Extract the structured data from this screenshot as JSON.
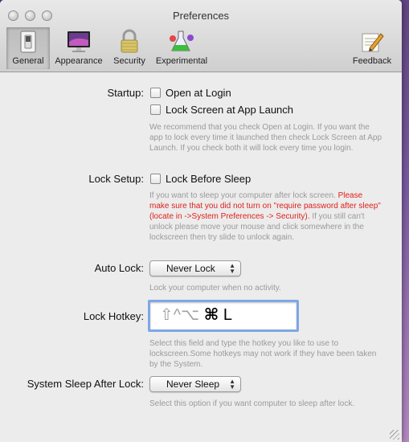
{
  "window": {
    "title": "Preferences"
  },
  "toolbar": {
    "items": [
      {
        "label": "General",
        "icon": "switch-icon",
        "active": true
      },
      {
        "label": "Appearance",
        "icon": "monitor-icon",
        "active": false
      },
      {
        "label": "Security",
        "icon": "lock-icon",
        "active": false
      },
      {
        "label": "Experimental",
        "icon": "flask-icon",
        "active": false
      },
      {
        "label": "Feedback",
        "icon": "pencil-note-icon",
        "active": false
      }
    ]
  },
  "startup": {
    "label": "Startup:",
    "open_at_login": "Open at Login",
    "lock_at_launch": "Lock Screen at App Launch",
    "hint": "We recommend that you check Open at Login. If you want the app to lock every time it launched then check Lock Screen at App Launch. If you check both it will lock every time you login."
  },
  "lock_setup": {
    "label": "Lock Setup:",
    "lock_before_sleep": "Lock Before Sleep",
    "hint_prefix": "If you want to sleep your computer after lock screen.",
    "warning": "Please make sure that you did not turn on \"require password after sleep\" (locate in  ->System Preferences -> Security).",
    "hint_suffix": "If you still can't unlock please move your mouse and click somewhere in the lockscreen then try slide to unlock again."
  },
  "auto_lock": {
    "label": "Auto Lock:",
    "value": "Never Lock",
    "hint": "Lock your computer when no activity."
  },
  "hotkey": {
    "label": "Lock Hotkey:",
    "dim_keys": "⇧^⌥",
    "cmd": "⌘",
    "letter": "L",
    "hint": "Select this field and type the hotkey you like to use to lockscreen.Some hotkeys may not work if they have been taken by the System."
  },
  "sleep_after_lock": {
    "label": "System Sleep After Lock:",
    "value": "Never Sleep",
    "hint": "Select this option if you want computer to sleep after lock."
  }
}
